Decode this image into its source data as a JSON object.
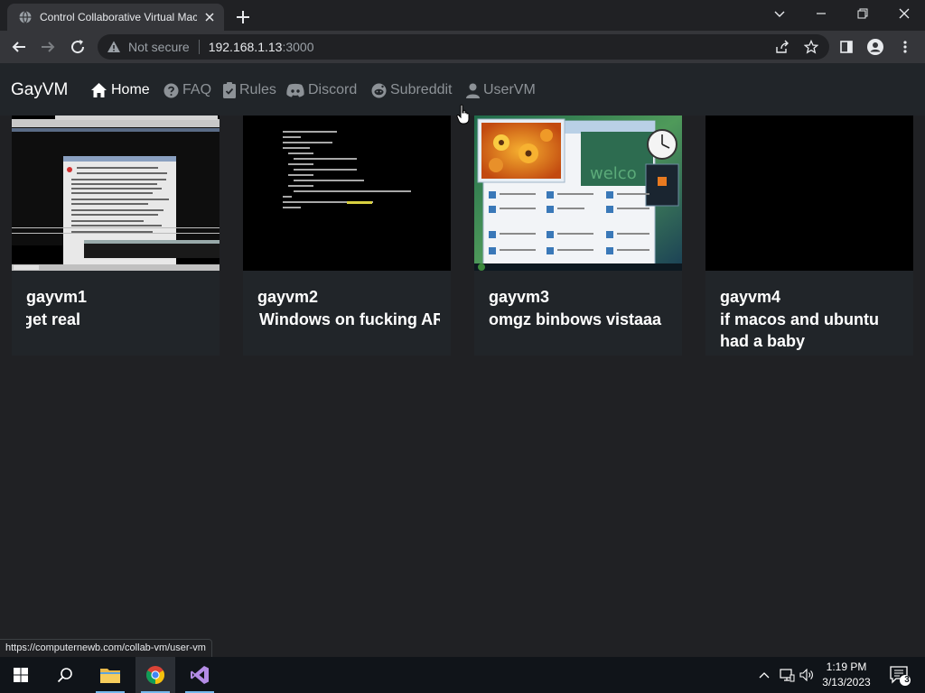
{
  "browser": {
    "tab_title": "Control Collaborative Virtual Mac",
    "not_secure_label": "Not secure",
    "url_host": "192.168.1.13",
    "url_port": ":3000",
    "status_url": "https://computernewb.com/collab-vm/user-vm"
  },
  "site": {
    "brand": "GayVM",
    "nav": [
      {
        "label": "Home",
        "icon": "home-icon",
        "active": true
      },
      {
        "label": "FAQ",
        "icon": "question-circle-icon"
      },
      {
        "label": "Rules",
        "icon": "clipboard-check-icon"
      },
      {
        "label": "Discord",
        "icon": "discord-icon"
      },
      {
        "label": "Subreddit",
        "icon": "reddit-icon"
      },
      {
        "label": "UserVM",
        "icon": "person-icon"
      }
    ]
  },
  "vms": [
    {
      "name": "gayvm1",
      "description": "get real"
    },
    {
      "name": "gayvm2",
      "description": "Windows on fucking ARM"
    },
    {
      "name": "gayvm3",
      "description": "omgz binbows vistaaa"
    },
    {
      "name": "gayvm4",
      "description": "if macos and ubuntu had a baby"
    }
  ],
  "taskbar": {
    "time": "1:19 PM",
    "date": "3/13/2023",
    "notification_count": "3"
  },
  "colors": {
    "page_bg": "#202124",
    "card_bg": "#212529",
    "nav_muted": "#8d9297",
    "taskbar_bg": "#101419",
    "accent": "#76b9ed"
  }
}
